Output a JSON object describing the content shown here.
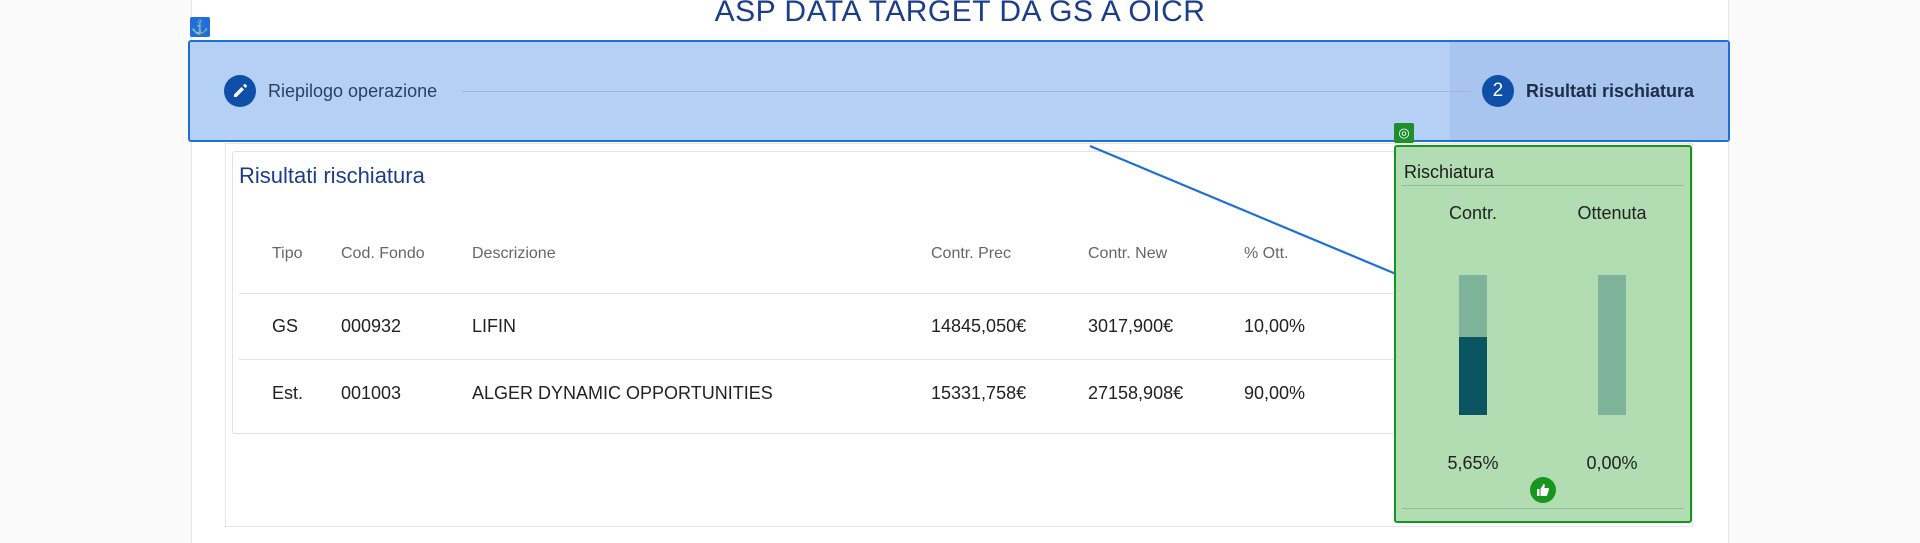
{
  "page": {
    "title": "ASP DATA TARGET DA GS A OICR"
  },
  "stepper": {
    "steps": [
      {
        "icon": "pencil-icon",
        "label": "Riepilogo operazione"
      },
      {
        "number": "2",
        "label": "Risultati rischiatura"
      }
    ]
  },
  "results": {
    "title": "Risultati rischiatura",
    "columns": [
      "Tipo",
      "Cod. Fondo",
      "Descrizione",
      "Contr. Prec",
      "Contr. New",
      "% Ott."
    ],
    "rows": [
      [
        "GS",
        "000932",
        "LIFIN",
        "14845,050€",
        "3017,900€",
        "10,00%"
      ],
      [
        "Est.",
        "001003",
        "ALGER DYNAMIC OPPORTUNITIES",
        "15331,758€",
        "27158,908€",
        "90,00%"
      ]
    ]
  },
  "rischiatura": {
    "title": "Rischiatura",
    "col_contr": "Contr.",
    "col_ottenuta": "Ottenuta",
    "contr_value": "5,65%",
    "ottenuta_value": "0,00%",
    "contr_fill_fraction": 0.56,
    "ottenuta_fill_fraction": 0.0
  },
  "colors": {
    "primary": "#1a3d8c",
    "overlay_blue": "#1f6fd8",
    "overlay_green": "#16951f",
    "bar_fill": "#0b5563"
  }
}
